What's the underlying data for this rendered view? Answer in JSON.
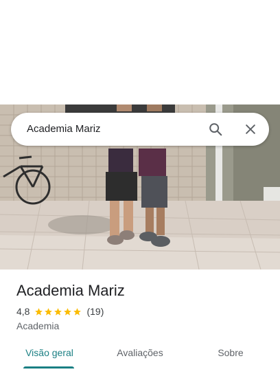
{
  "search": {
    "query": "Academia Mariz",
    "search_icon": "search-icon",
    "clear_icon": "close-icon"
  },
  "place": {
    "name": "Academia Mariz",
    "rating": "4,8",
    "stars": 5,
    "review_count": "(19)",
    "category": "Academia"
  },
  "tabs": [
    {
      "label": "Visão geral",
      "active": true
    },
    {
      "label": "Avaliações",
      "active": false
    },
    {
      "label": "Sobre",
      "active": false
    }
  ],
  "colors": {
    "accent": "#1a7f83",
    "star": "#fbbc04"
  }
}
